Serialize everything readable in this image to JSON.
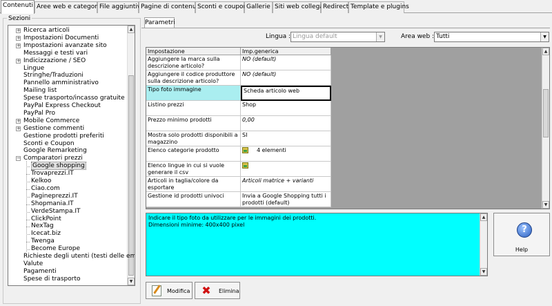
{
  "tabs": [
    {
      "label": "Contenuti",
      "active": true
    },
    {
      "label": "Aree web e categorie"
    },
    {
      "label": "File aggiuntivi"
    },
    {
      "label": "Pagine di contenuti"
    },
    {
      "label": "Sconti e coupon"
    },
    {
      "label": "Gallerie"
    },
    {
      "label": "Siti web collegati"
    },
    {
      "label": "Redirect"
    },
    {
      "label": "Template e plugins"
    }
  ],
  "sections": {
    "title": "Sezioni",
    "items": [
      {
        "label": "Ricerca articoli",
        "expandable": true
      },
      {
        "label": "Impostazioni Documenti",
        "expandable": true
      },
      {
        "label": "Impostazioni avanzate sito",
        "expandable": true
      },
      {
        "label": "Messaggi e testi vari"
      },
      {
        "label": "Indicizzazione / SEO",
        "expandable": true
      },
      {
        "label": "Lingue"
      },
      {
        "label": "Stringhe/Traduzioni"
      },
      {
        "label": "Pannello amministrativo"
      },
      {
        "label": "Mailing list"
      },
      {
        "label": "Spese trasporto/incasso gratuite"
      },
      {
        "label": "PayPal Express Checkout"
      },
      {
        "label": "PayPal Pro"
      },
      {
        "label": "Mobile Commerce",
        "expandable": true
      },
      {
        "label": "Gestione commenti",
        "expandable": true
      },
      {
        "label": "Gestione prodotti preferiti"
      },
      {
        "label": "Sconti e Coupon"
      },
      {
        "label": "Google Remarketing"
      },
      {
        "label": "Comparatori prezzi",
        "expanded": true
      },
      {
        "label": "Google shopping",
        "child": true,
        "selected": true
      },
      {
        "label": "Trovaprezzi.IT",
        "child": true
      },
      {
        "label": "Kelkoo",
        "child": true
      },
      {
        "label": "Ciao.com",
        "child": true
      },
      {
        "label": "Pagineprezzi.IT",
        "child": true
      },
      {
        "label": "Shopmania.IT",
        "child": true
      },
      {
        "label": "VerdeStampa.IT",
        "child": true
      },
      {
        "label": "ClickPoint",
        "child": true
      },
      {
        "label": "NexTag",
        "child": true
      },
      {
        "label": "Icecat.biz",
        "child": true
      },
      {
        "label": "Twenga",
        "child": true
      },
      {
        "label": "Become Europe",
        "child": true
      },
      {
        "label": "Richieste degli utenti (testi delle email)"
      },
      {
        "label": "Valute"
      },
      {
        "label": "Pagamenti"
      },
      {
        "label": "Spese di trasporto"
      }
    ]
  },
  "parametri": {
    "tab_label": "Parametri",
    "lingua_label": "Lingua :",
    "lingua_value": "Lingua default",
    "area_label": "Area web :",
    "area_value": "Tutti"
  },
  "grid": {
    "headers": [
      "Impostazione",
      "Imp.generica"
    ],
    "rows": [
      {
        "setting": "Aggiungere la marca sulla descrizione articolo?",
        "value": "NO (default)",
        "italic": true
      },
      {
        "setting": "Aggiungere il codice produttore sulla descrizione articolo?",
        "value": "NO (default)",
        "italic": true
      },
      {
        "setting": "Tipo foto immagine",
        "value": "Scheda articolo web",
        "selected": true
      },
      {
        "setting": "Listino prezzi",
        "value": "Shop"
      },
      {
        "setting": "Prezzo minimo prodotti",
        "value": "0,00",
        "italic": true
      },
      {
        "setting": "Mostra solo prodotti disponibili a magazzino",
        "value": "SI"
      },
      {
        "setting": "Elenco categorie prodotto",
        "value": "4 elementi",
        "icon": "category-icon"
      },
      {
        "setting": "Elenco lingue in cui si vuole generare il csv",
        "value": "",
        "icon": "category-icon"
      },
      {
        "setting": "Articoli in taglia/colore da esportare",
        "value": "Articoli matrice + varianti",
        "italic": true
      },
      {
        "setting": "Gestione id prodotti univoci",
        "value": "Invia a Google Shopping tutti i prodotti (default)"
      }
    ]
  },
  "description": {
    "lines": [
      "Indicare il tipo foto da utilizzare per le immagini dei prodotti.",
      "Dimensioni minime: 400x400 pixel"
    ]
  },
  "buttons": {
    "help": "Help",
    "modifica": "Modifica",
    "elimina": "Elimina"
  },
  "colors": {
    "selection": "#aaeef0",
    "description_bg": "#00ffff",
    "grid_bg": "#a0a0a0"
  }
}
